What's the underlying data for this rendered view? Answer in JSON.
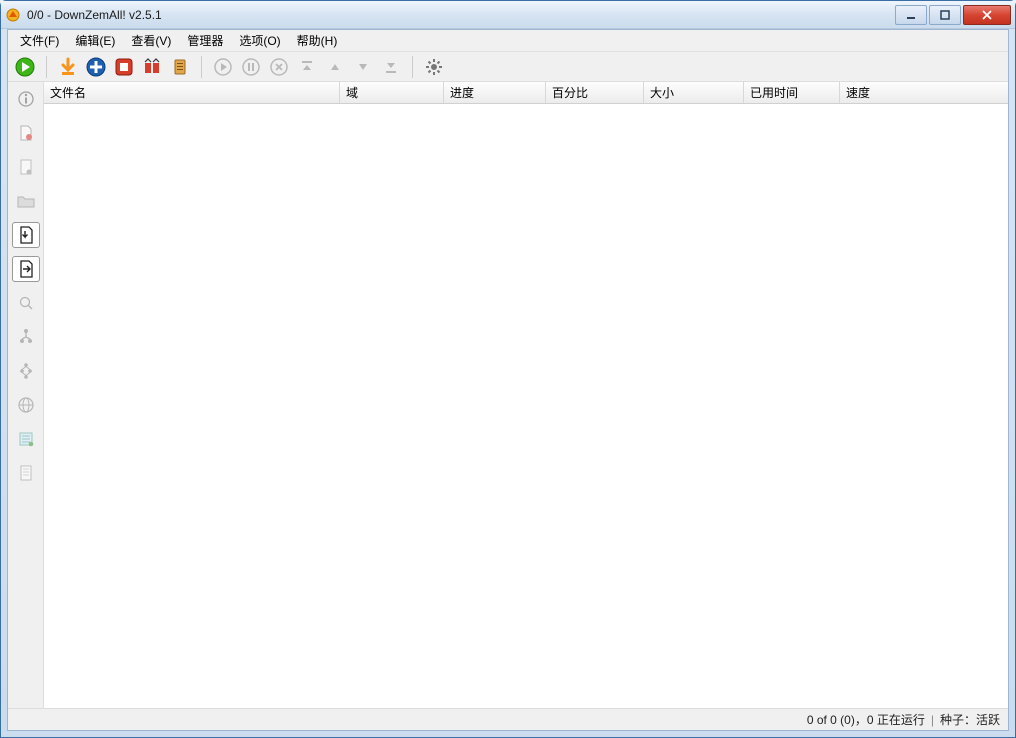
{
  "title": "0/0 - DownZemAll! v2.5.1",
  "menu": {
    "file": "文件(F)",
    "edit": "编辑(E)",
    "view": "查看(V)",
    "manager": "管理器",
    "options": "选项(O)",
    "help": "帮助(H)"
  },
  "table": {
    "columns": {
      "filename": "文件名",
      "domain": "域",
      "progress": "进度",
      "percent": "百分比",
      "size": "大小",
      "elapsed": "已用时间",
      "speed": "速度"
    }
  },
  "status": {
    "summary": "0 of 0 (0)，0 正在运行",
    "seed": "种子：活跃"
  }
}
